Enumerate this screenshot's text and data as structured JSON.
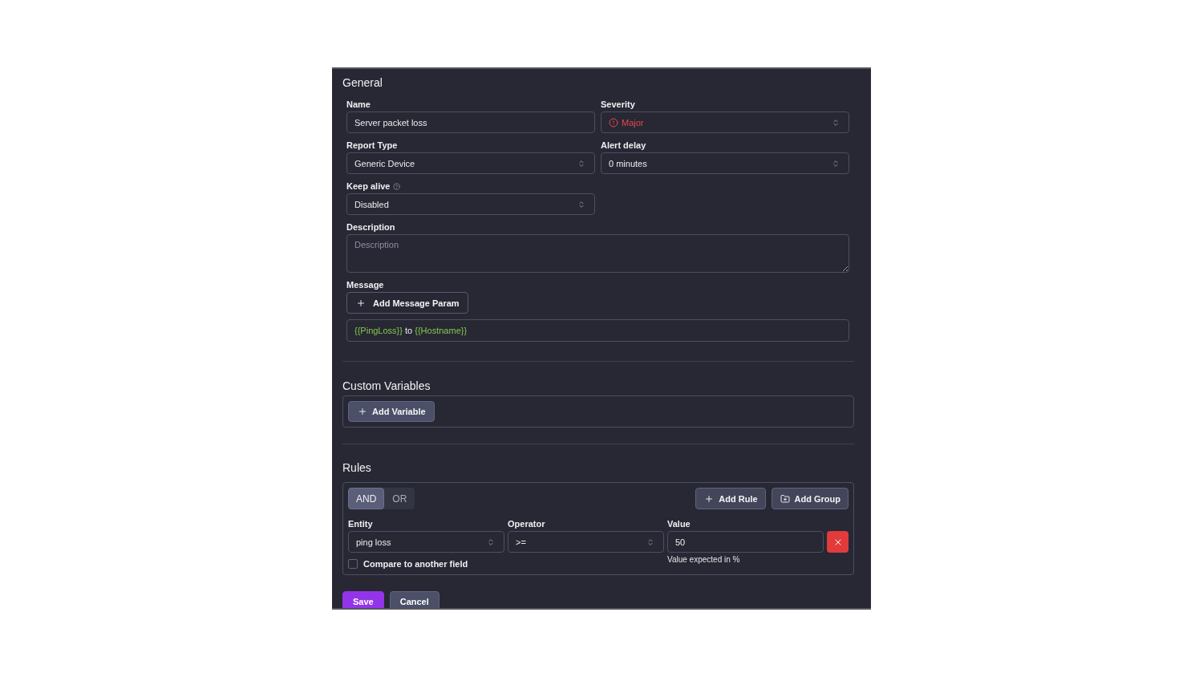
{
  "general": {
    "title": "General",
    "fields": [
      {
        "kind": "input",
        "label": "Name",
        "value": "Server packet loss",
        "help": false
      },
      {
        "kind": "severity",
        "label": "Severity",
        "value": "Major",
        "help": false
      },
      {
        "kind": "select",
        "label": "Report Type",
        "value": "Generic Device",
        "help": false
      },
      {
        "kind": "select",
        "label": "Alert delay",
        "value": "0 minutes",
        "help": false
      },
      {
        "kind": "select",
        "label": "Keep alive",
        "value": "Disabled",
        "help": true
      },
      {
        "kind": "textarea",
        "label": "Description",
        "placeholder": "Description",
        "help": false
      }
    ],
    "message": {
      "label": "Message",
      "add_button": "Add Message Param",
      "template": [
        {
          "kind": "param",
          "text": "{{PingLoss}}"
        },
        {
          "kind": "plain",
          "text": "to"
        },
        {
          "kind": "param",
          "text": "{{Hostname}}"
        }
      ]
    }
  },
  "custom_variables": {
    "title": "Custom Variables",
    "add_button": "Add Variable"
  },
  "rules": {
    "title": "Rules",
    "logic": [
      {
        "label": "AND",
        "selected": true
      },
      {
        "label": "OR",
        "selected": false
      }
    ],
    "actions": [
      {
        "kind": "rule",
        "label": "Add Rule"
      },
      {
        "kind": "group",
        "label": "Add Group"
      }
    ],
    "conditions": [
      {
        "entity": {
          "label": "Entity",
          "value": "ping loss"
        },
        "operator": {
          "label": "Operator",
          "value": ">="
        },
        "value": {
          "label": "Value",
          "value": "50",
          "hint": "Value expected in %"
        },
        "compare": {
          "label": "Compare to another field",
          "checked": false
        }
      }
    ]
  },
  "buttons": [
    {
      "kind": "primary",
      "label": "Save"
    },
    {
      "kind": "secondary",
      "label": "Cancel"
    }
  ]
}
